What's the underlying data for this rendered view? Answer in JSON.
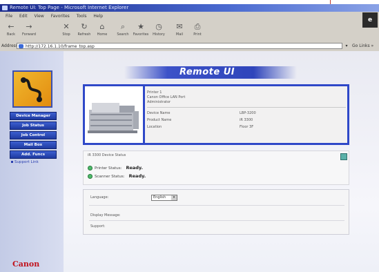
{
  "window": {
    "title": "Remote UI: Top Page - Microsoft Internet Explorer"
  },
  "menubar": {
    "items": [
      "File",
      "Edit",
      "View",
      "Favorites",
      "Tools",
      "Help"
    ]
  },
  "toolbar": {
    "buttons": [
      {
        "icon": "back-arrow",
        "label": "Back"
      },
      {
        "icon": "forward-arrow",
        "label": "Forward"
      },
      {
        "icon": "stop",
        "label": "Stop"
      },
      {
        "icon": "refresh",
        "label": "Refresh"
      },
      {
        "icon": "home",
        "label": "Home"
      },
      {
        "icon": "search",
        "label": "Search"
      },
      {
        "icon": "favorites",
        "label": "Favorites"
      },
      {
        "icon": "history",
        "label": "History"
      },
      {
        "icon": "mail",
        "label": "Mail"
      },
      {
        "icon": "print",
        "label": "Print"
      }
    ]
  },
  "address": {
    "label": "Address",
    "value": "http://172.16.1.10/frame_top.asp",
    "go_label": "▾",
    "links_label": "Go  Links »"
  },
  "sidebar": {
    "nav": [
      "Device Manager",
      "Job Status",
      "Job Control",
      "Mail Box",
      "Add. Funcs"
    ],
    "link": "Support Link",
    "brand": "Canon"
  },
  "banner": {
    "text": "Remote UI"
  },
  "device": {
    "name": "Printer 1",
    "location": "Canon Office LAN Port",
    "admin": "Administrator",
    "rows": [
      {
        "label": "Device Name",
        "value": "LBP-3200"
      },
      {
        "label": "Product Name",
        "value": "iR 3300"
      },
      {
        "label": "Location",
        "value": "Floor 3F"
      }
    ]
  },
  "status": {
    "title": "iR 3300 Device Status",
    "printer_label": "Printer Status:",
    "printer_value": "Ready.",
    "scanner_label": "Scanner Status:",
    "scanner_value": "Ready."
  },
  "messages": {
    "language_label": "Language:",
    "language_value": "English",
    "message_label": "Display Message:",
    "support_label": "Support:"
  },
  "colors": {
    "accent": "#2f48c8",
    "brand": "#c1121c",
    "status_ok": "#4dba6a"
  }
}
